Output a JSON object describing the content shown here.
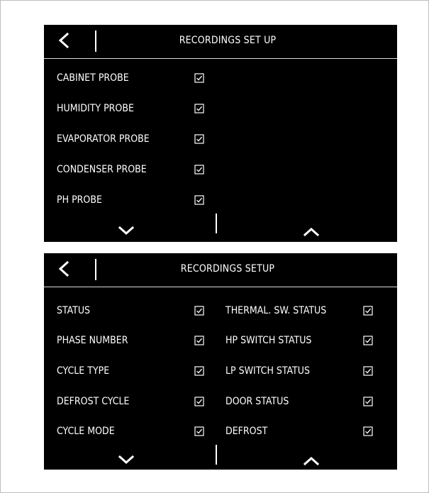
{
  "screen1": {
    "title": "RECORDINGS SET UP",
    "items": [
      {
        "label": "CABINET PROBE",
        "checked": true
      },
      {
        "label": "HUMIDITY PROBE",
        "checked": true
      },
      {
        "label": "EVAPORATOR PROBE",
        "checked": true
      },
      {
        "label": "CONDENSER PROBE",
        "checked": true
      },
      {
        "label": "PH PROBE",
        "checked": true
      }
    ]
  },
  "screen2": {
    "title": "RECORDINGS SETUP",
    "left_items": [
      {
        "label": "STATUS",
        "checked": true
      },
      {
        "label": "PHASE NUMBER",
        "checked": true
      },
      {
        "label": "CYCLE TYPE",
        "checked": true
      },
      {
        "label": "DEFROST CYCLE",
        "checked": true
      },
      {
        "label": "CYCLE MODE",
        "checked": true
      }
    ],
    "right_items": [
      {
        "label": "THERMAL. SW. STATUS",
        "checked": true
      },
      {
        "label": "HP SWITCH STATUS",
        "checked": true
      },
      {
        "label": "LP SWITCH STATUS",
        "checked": true
      },
      {
        "label": "DOOR STATUS",
        "checked": true
      },
      {
        "label": "DEFROST",
        "checked": true
      }
    ]
  },
  "icons": {
    "back": "chevron-left-icon",
    "scroll_down": "chevron-down-icon",
    "scroll_up": "chevron-up-icon",
    "checkbox": "checkbox-checked-icon"
  },
  "colors": {
    "screen_background": "#000000",
    "text": "#ffffff",
    "frame_border": "#bdbdbd"
  }
}
